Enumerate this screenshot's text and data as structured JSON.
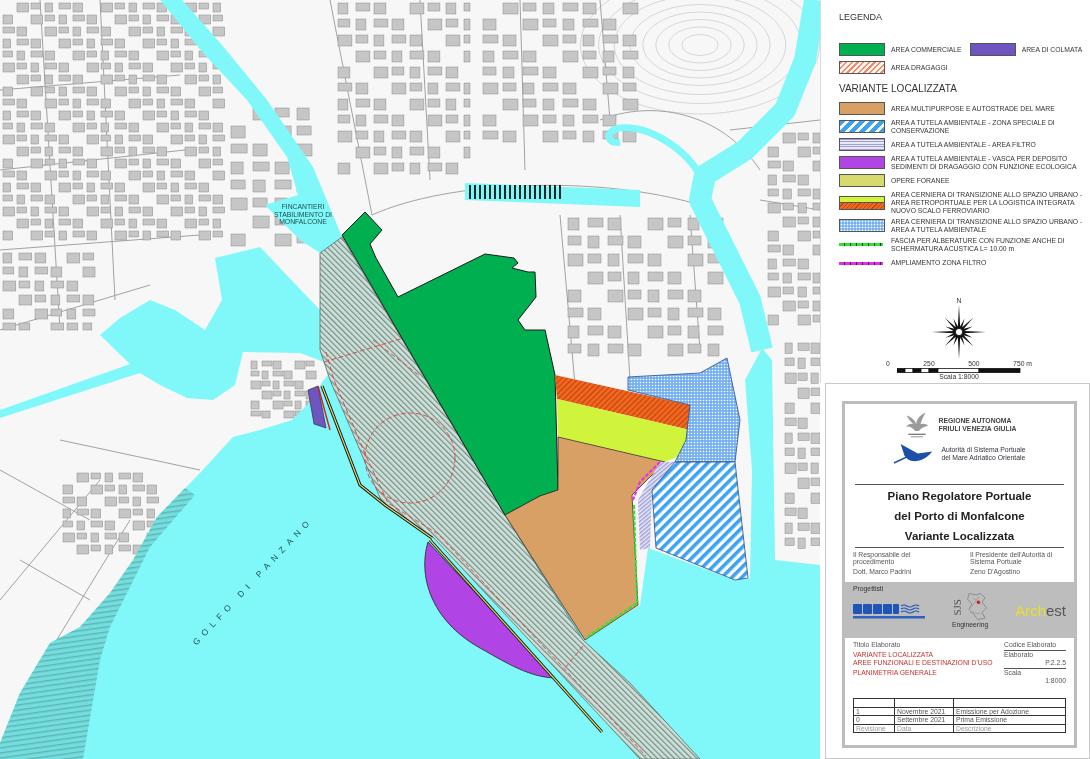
{
  "map": {
    "sea_label": "GOLFO DI PANZANO",
    "shipyard_label": [
      "FINCANTIERI",
      "STABILIMENTO DI",
      "MONFALCONE"
    ]
  },
  "legend": {
    "title": "LEGENDA",
    "existing_items": [
      {
        "label": "AREA COMMERCIALE",
        "kind": "fill",
        "color": "#00b050"
      },
      {
        "label": "AREA DI COLMATA",
        "kind": "fill",
        "color": "#6e55c0"
      },
      {
        "label": "AREA DRAGAGGI",
        "kind": "hatch",
        "color": "#f08a6a"
      }
    ],
    "section_title": "VARIANTE LOCALIZZATA",
    "items": [
      {
        "label": "AREA MULTIPURPOSE E AUTOSTRADE DEL MARE",
        "kind": "fill",
        "color": "#d9a066"
      },
      {
        "label": "AREA A TUTELA AMBIENTALE - ZONA SPECIALE DI CONSERVAZIONE",
        "kind": "wide-hatch",
        "color": "#3da2f2"
      },
      {
        "label": "AREA A TUTELA AMBIENTALE - AREA FILTRO",
        "kind": "stripes",
        "color": "#9e9ed8"
      },
      {
        "label": "AREA A TUTELA AMBIENTALE - VASCA PER DEPOSITO SEDIMENTI DI DRAGAGGIO CON FUNZIONE ECOLOGICA",
        "kind": "fill",
        "color": "#b044e4"
      },
      {
        "label": "OPERE FORANEE",
        "kind": "fill",
        "color": "#d8da6e"
      },
      {
        "label": "AREA CERNIERA DI TRANSIZIONE ALLO SPAZIO URBANO - AREA RETROPORTUALE PER LA LOGISTICA INTEGRATA",
        "kind": "split",
        "color": "#d0f43c",
        "lower": {
          "label": "NUOVO SCALO FERROVIARIO",
          "kind": "dense-hatch",
          "color": "#f06a1c"
        }
      },
      {
        "label": "AREA CERNIERA DI TRANSIZIONE ALLO SPAZIO URBANO - AREA A TUTELA AMBIENTALE",
        "kind": "dots",
        "color": "#74b0f0"
      },
      {
        "label": "FASCIA PER ALBERATURE CON FUNZIONE ANCHE DI SCHERMATURA ACUSTICA L= 10.00 m",
        "kind": "dashed-line",
        "color": "#2be62b"
      },
      {
        "label": "AMPLIAMENTO ZONA FILTRO",
        "kind": "dashed-line",
        "color": "#e82ee8"
      }
    ],
    "north_label": "N",
    "scale_bar": {
      "ticks": [
        "0",
        "250",
        "500",
        "750 m"
      ],
      "caption": "Scala 1:8000"
    }
  },
  "title_block": {
    "region_name": [
      "REGIONE AUTONOMA",
      "FRIULI VENEZIA GIULIA"
    ],
    "authority_name": [
      "Autorità di Sistema Portuale",
      "del Mare Adriatico Orientale"
    ],
    "plan_title": [
      "Piano Regolatore Portuale",
      "del Porto di Monfalcone",
      "Variante Localizzata"
    ],
    "signatures": [
      {
        "role": "Il Responsabile del procedimento",
        "name": "Dott. Marco Padrini"
      },
      {
        "role": "Il Presidente dell'Autorità di Sistema Portuale",
        "name": "Zeno D'Agostino"
      }
    ],
    "designers": {
      "label": "Progettisti",
      "sjs_logo": {
        "mark": "SJS",
        "caption": "Engineering"
      },
      "archest_logo": {
        "part_1": "Arch",
        "part_2": "est"
      }
    },
    "drawing": {
      "title_label": "Titolo Elaborato",
      "code_label": "Codice Elaborato",
      "title_lines": [
        "VARIANTE LOCALIZZATA",
        "AREE FUNZIONALI E DESTINAZIONI D'USO"
      ],
      "subtitle": "PLANIMETRIA GENERALE",
      "fields": [
        {
          "label": "Elaborato",
          "value": "P.2.2.5"
        },
        {
          "label": "Scala",
          "value": "1:8000"
        }
      ]
    },
    "revisions": {
      "rows": [
        [
          "1",
          "Novembre 2021",
          "Emissione per Adozione"
        ],
        [
          "0",
          "Settembre 2021",
          "Prima Emissione"
        ]
      ],
      "footer": [
        "Revisione",
        "Data",
        "Descrizione"
      ]
    }
  }
}
